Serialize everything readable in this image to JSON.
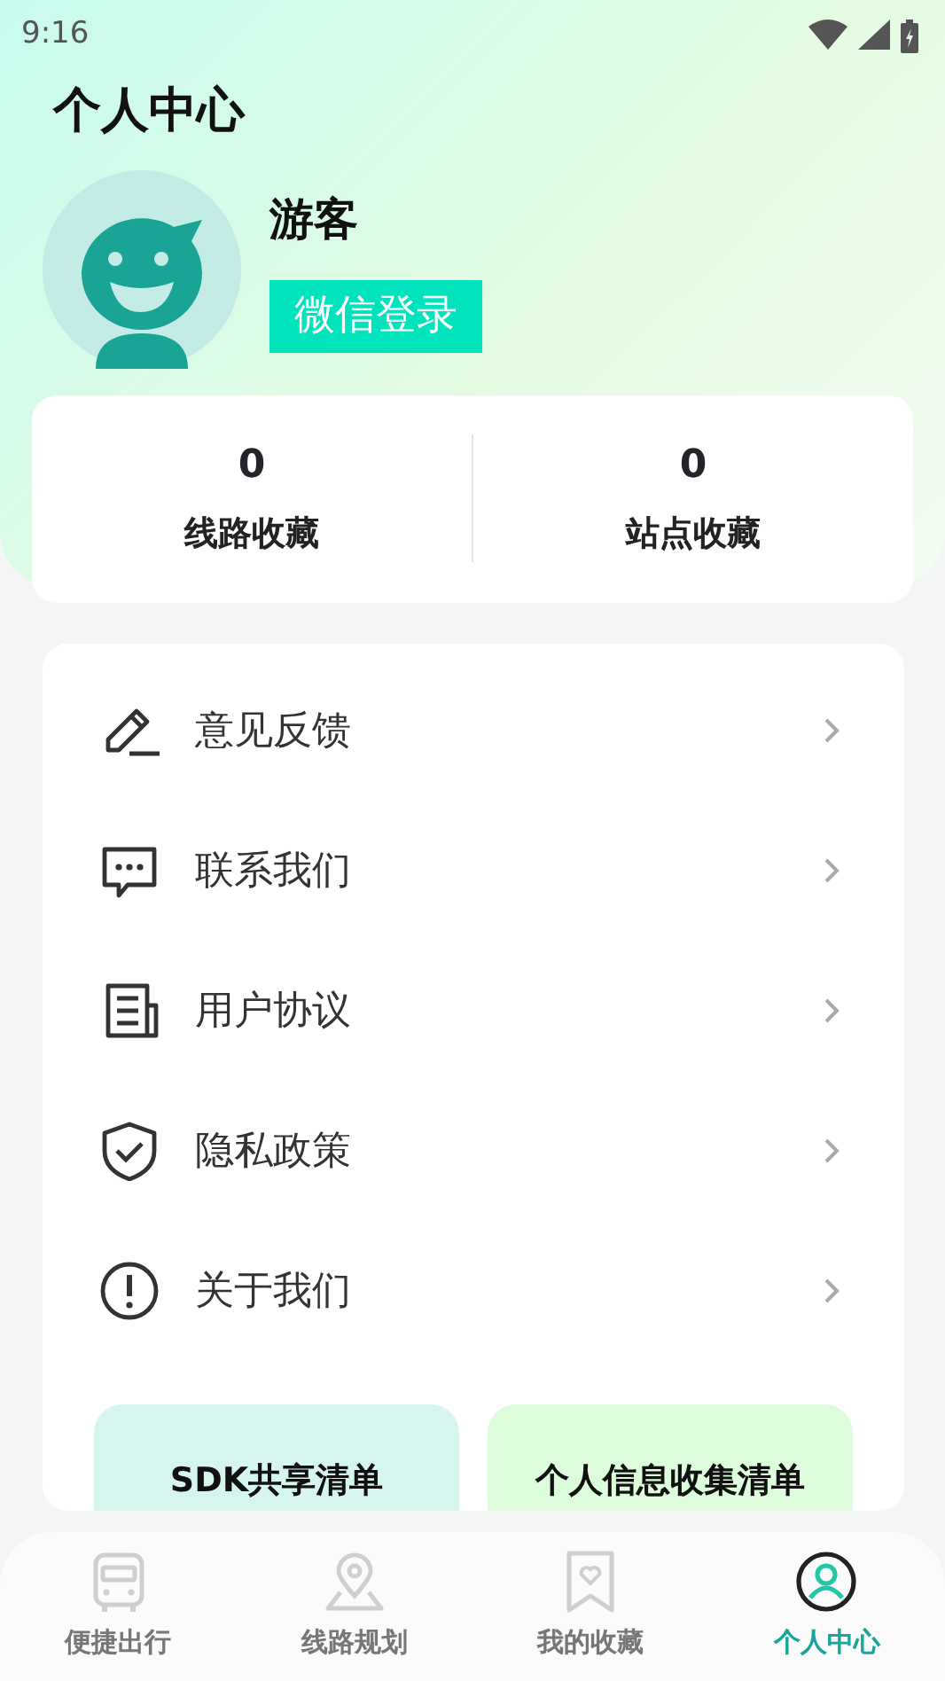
{
  "status_bar": {
    "time": "9:16"
  },
  "title": "个人中心",
  "profile": {
    "name": "游客",
    "login_button": "微信登录"
  },
  "stats": [
    {
      "value": "0",
      "label": "线路收藏"
    },
    {
      "value": "0",
      "label": "站点收藏"
    }
  ],
  "menu": [
    {
      "kind": "pencil",
      "label": "意见反馈"
    },
    {
      "kind": "chat",
      "label": "联系我们"
    },
    {
      "kind": "document",
      "label": "用户协议"
    },
    {
      "kind": "shield",
      "label": "隐私政策"
    },
    {
      "kind": "info",
      "label": "关于我们"
    }
  ],
  "lists": [
    {
      "label": "SDK共享清单",
      "color": "#d6f5ef"
    },
    {
      "label": "个人信息收集清单",
      "color": "#dcfcdc"
    }
  ],
  "tabs": [
    {
      "kind": "bus",
      "label": "便捷出行",
      "selected": false
    },
    {
      "kind": "map",
      "label": "线路规划",
      "selected": false
    },
    {
      "kind": "bookmark",
      "label": "我的收藏",
      "selected": false
    },
    {
      "kind": "person",
      "label": "个人中心",
      "selected": true
    }
  ]
}
